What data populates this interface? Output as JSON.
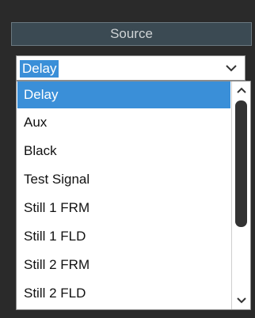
{
  "header": {
    "title": "Source"
  },
  "select": {
    "value": "Delay"
  },
  "list": {
    "items": [
      {
        "label": "Delay",
        "selected": true
      },
      {
        "label": "Aux",
        "selected": false
      },
      {
        "label": "Black",
        "selected": false
      },
      {
        "label": "Test Signal",
        "selected": false
      },
      {
        "label": "Still 1 FRM",
        "selected": false
      },
      {
        "label": "Still 1 FLD",
        "selected": false
      },
      {
        "label": "Still 2 FRM",
        "selected": false
      },
      {
        "label": "Still 2 FLD",
        "selected": false
      }
    ]
  },
  "colors": {
    "accent": "#3a8fd8",
    "header_bg": "#3b4a53",
    "background": "#2a2a2a"
  },
  "icons": {
    "dropdown": "chevron-down-icon",
    "scroll_up": "chevron-up-icon",
    "scroll_down": "chevron-down-icon"
  }
}
